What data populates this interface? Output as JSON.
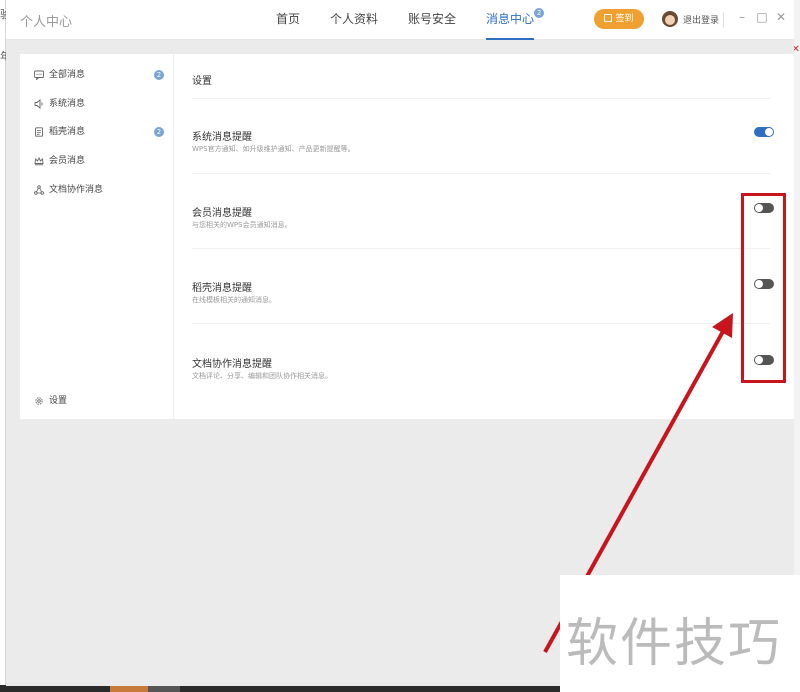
{
  "backdrop": {
    "left_glyph_1": "验",
    "left_glyph_2": "年"
  },
  "app": {
    "title": "个人中心"
  },
  "nav": {
    "items": [
      {
        "label": "首页"
      },
      {
        "label": "个人资料"
      },
      {
        "label": "账号安全"
      },
      {
        "label": "消息中心",
        "badge": "2"
      }
    ]
  },
  "header": {
    "signin_label": "签到",
    "logout_label": "退出登录"
  },
  "sidebar": {
    "items": [
      {
        "label": "全部消息",
        "badge": "2",
        "icon": "chat-bubble-icon"
      },
      {
        "label": "系统消息",
        "icon": "speaker-icon"
      },
      {
        "label": "稻壳消息",
        "badge": "2",
        "icon": "document-icon"
      },
      {
        "label": "会员消息",
        "icon": "crown-icon"
      },
      {
        "label": "文档协作消息",
        "icon": "collaboration-icon"
      }
    ],
    "settings_label": "设置"
  },
  "main": {
    "section_title": "设置",
    "settings": [
      {
        "title": "系统消息提醒",
        "desc": "WPS官方通知、如升级维护通知、产品更新提醒等。",
        "enabled": true
      },
      {
        "title": "会员消息提醒",
        "desc": "与您相关的WPS会员通知消息。",
        "enabled": false
      },
      {
        "title": "稻壳消息提醒",
        "desc": "在线模板相关的通知消息。",
        "enabled": false
      },
      {
        "title": "文档协作消息提醒",
        "desc": "文档评论、分享、编辑和团队协作相关消息。",
        "enabled": false
      }
    ]
  },
  "watermark": {
    "text": "软件技巧"
  },
  "colors": {
    "accent": "#2e6fc4",
    "signin": "#f0a030",
    "annotation": "#c8141c"
  }
}
